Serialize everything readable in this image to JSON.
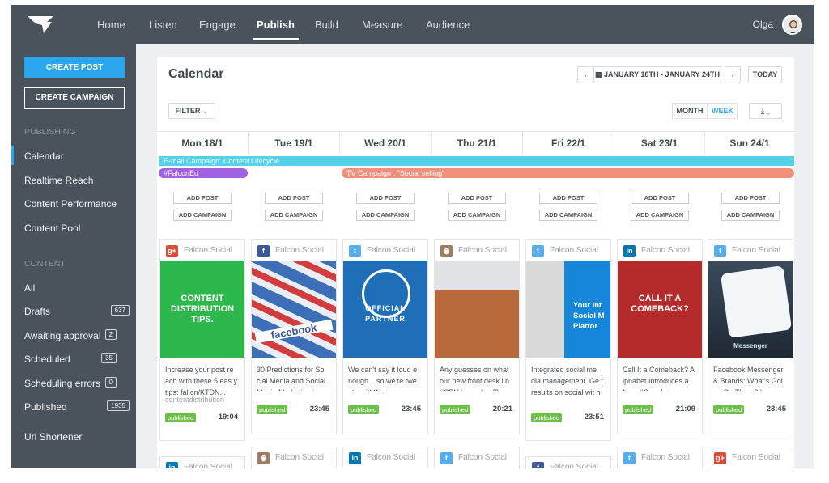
{
  "topnav": {
    "items": [
      "Home",
      "Listen",
      "Engage",
      "Publish",
      "Build",
      "Measure",
      "Audience"
    ],
    "active": "Publish",
    "user": "Olga"
  },
  "sidebar": {
    "create_post": "CREATE POST",
    "create_campaign": "CREATE CAMPAIGN",
    "publishing_heading": "PUBLISHING",
    "publishing_items": [
      "Calendar",
      "Realtime Reach",
      "Content Performance",
      "Content Pool"
    ],
    "content_heading": "CONTENT",
    "content_items": [
      {
        "label": "All",
        "count": ""
      },
      {
        "label": "Drafts",
        "count": "637"
      },
      {
        "label": "Awaiting approval",
        "count": "2"
      },
      {
        "label": "Scheduled",
        "count": "35"
      },
      {
        "label": "Scheduling errors",
        "count": "0"
      },
      {
        "label": "Published",
        "count": "1935"
      }
    ],
    "url_shortener": "Url Shortener"
  },
  "calendar": {
    "title": "Calendar",
    "date_range": "JANUARY 18TH - JANUARY 24TH",
    "today": "TODAY",
    "filter": "FILTER",
    "month": "MONTH",
    "week": "WEEK",
    "days": [
      "Mon 18/1",
      "Tue 19/1",
      "Wed 20/1",
      "Thu 21/1",
      "Fri 22/1",
      "Sat 23/1",
      "Sun 24/1"
    ],
    "campaigns": [
      {
        "label": "E-mail Campaign: Content Lifecycle",
        "color": "#56d2e8"
      },
      {
        "label": "#FalconEd",
        "color": "#a062e0"
      },
      {
        "label": "TV Campaign : \"Social selling\"",
        "color": "#f0907a"
      }
    ],
    "add_post": "ADD POST",
    "add_campaign": "ADD CAMPAIGN",
    "posts": [
      {
        "network": "g+",
        "account": "Falcon Social",
        "text": "Increase your post re ach with these 5 eas y tips: fal.cn/KTDN...",
        "sub": "contentdistribution",
        "status": "published",
        "time": "19:04",
        "image_text": "CONTENT DISTRIBUTION TIPS."
      },
      {
        "network": "f",
        "account": "Falcon Social",
        "text": "30 Predictions for So cial Media and Social Media Marketing in...",
        "sub": "",
        "status": "published",
        "time": "23:45",
        "image_text": "facebook"
      },
      {
        "network": "t",
        "account": "Falcon Social",
        "text": "We can't say it loud e nough... so we're twe eting it! We're an...",
        "sub": "",
        "status": "published",
        "time": "23:45",
        "image_text": "OFFICIAL PARTNER"
      },
      {
        "network": "ig",
        "account": "Falcon Social",
        "text": "Any guesses on what our new front desk i n #CPH is made of?...",
        "sub": "",
        "status": "published",
        "time": "20:21",
        "image_text": ""
      },
      {
        "network": "t",
        "account": "Falcon Social",
        "text": "Integrated social me dia management. Ge t results on social wit h a...",
        "sub": "",
        "status": "published",
        "time": "23:51",
        "image_text": "Your Int Social M Platfor"
      },
      {
        "network": "in",
        "account": "Falcon Social",
        "text": "Call It a Comeback? A lphabet Introduces a New #Google+:...",
        "sub": "",
        "status": "published",
        "time": "21:09",
        "image_text": "CALL IT A COMEBACK?"
      },
      {
        "network": "t",
        "account": "Falcon Social",
        "text": "Facebook Messenger & Brands: What's Goi ng On There? by...",
        "sub": "",
        "status": "published",
        "time": "23:45",
        "image_text": "Messenger"
      }
    ],
    "next_row": [
      {
        "network": "in",
        "account": "Falcon Social"
      },
      {
        "network": "ig",
        "account": "Falcon Social"
      },
      {
        "network": "in",
        "account": "Falcon Social"
      },
      {
        "network": "t",
        "account": "Falcon Social"
      },
      {
        "network": "f",
        "account": "Falcon Social"
      },
      {
        "network": "t",
        "account": "Falcon Social"
      },
      {
        "network": "g+",
        "account": "Falcon Social"
      }
    ]
  }
}
